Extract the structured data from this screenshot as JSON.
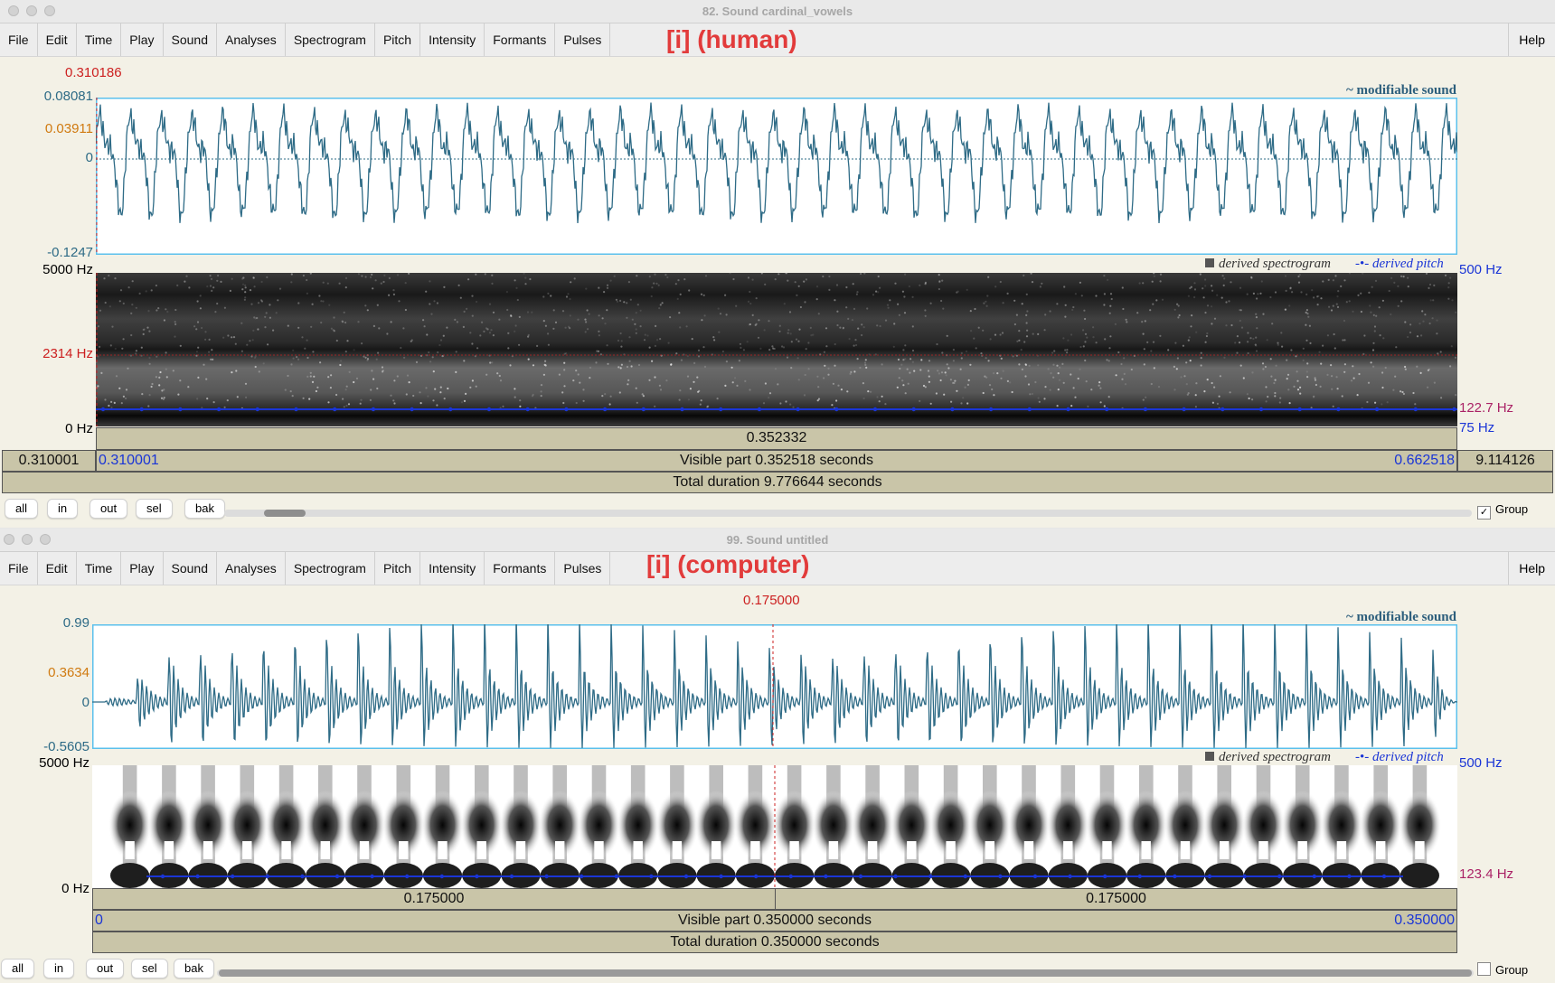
{
  "windows": [
    {
      "title": "82. Sound cardinal_vowels",
      "menu": [
        "File",
        "Edit",
        "Time",
        "Play",
        "Sound",
        "Analyses",
        "Spectrogram",
        "Pitch",
        "Intensity",
        "Formants",
        "Pulses"
      ],
      "help": "Help",
      "overlay_title": "[i] (human)",
      "cursor_time": "0.310186",
      "amp_max": "0.08081",
      "amp_cursor": "0.03911",
      "amp_zero": "0",
      "amp_min": "-0.1247",
      "wave_legend": "modifiable sound",
      "spec_legend": "derived spectrogram",
      "pitch_legend": "derived pitch",
      "freq_top": "5000 Hz",
      "freq_cursor": "2314 Hz",
      "freq_bottom": "0 Hz",
      "pitch_top": "500 Hz",
      "pitch_value": "122.7 Hz",
      "pitch_bottom": "75 Hz",
      "segment_label": "0.352332",
      "left_time": "0.310001",
      "view_start": "0.310001",
      "visible_part": "Visible part 0.352518 seconds",
      "view_end": "0.662518",
      "right_time": "9.114126",
      "total_duration": "Total duration 9.776644 seconds",
      "buttons": [
        "all",
        "in",
        "out",
        "sel",
        "bak"
      ],
      "group_label": "Group",
      "group_checked": true
    },
    {
      "title": "99. Sound untitled",
      "menu": [
        "File",
        "Edit",
        "Time",
        "Play",
        "Sound",
        "Analyses",
        "Spectrogram",
        "Pitch",
        "Intensity",
        "Formants",
        "Pulses"
      ],
      "help": "Help",
      "overlay_title": "[i] (computer)",
      "cursor_time": "0.175000",
      "amp_max": "0.99",
      "amp_cursor": "0.3634",
      "amp_zero": "0",
      "amp_min": "-0.5605",
      "wave_legend": "modifiable sound",
      "spec_legend": "derived spectrogram",
      "pitch_legend": "derived pitch",
      "freq_top": "5000 Hz",
      "freq_bottom": "0 Hz",
      "pitch_top": "500 Hz",
      "pitch_value": "123.4 Hz",
      "segment_left": "0.175000",
      "segment_right": "0.175000",
      "view_start": "0",
      "visible_part": "Visible part 0.350000 seconds",
      "view_end": "0.350000",
      "total_duration": "Total duration 0.350000 seconds",
      "buttons": [
        "all",
        "in",
        "out",
        "sel",
        "bak"
      ],
      "group_label": "Group",
      "group_checked": false
    }
  ],
  "colors": {
    "accent_title": "#e23b3b",
    "cursor": "#cc2020",
    "waveform": "#2e6b86",
    "selection_border": "#5bc0ec",
    "pitch_line": "#1a35d6",
    "pitch_label": "#aa2266",
    "amp_label": "#2e6b86",
    "cursor_amp_label": "#d07a10",
    "link_blue": "#1a35d6"
  }
}
